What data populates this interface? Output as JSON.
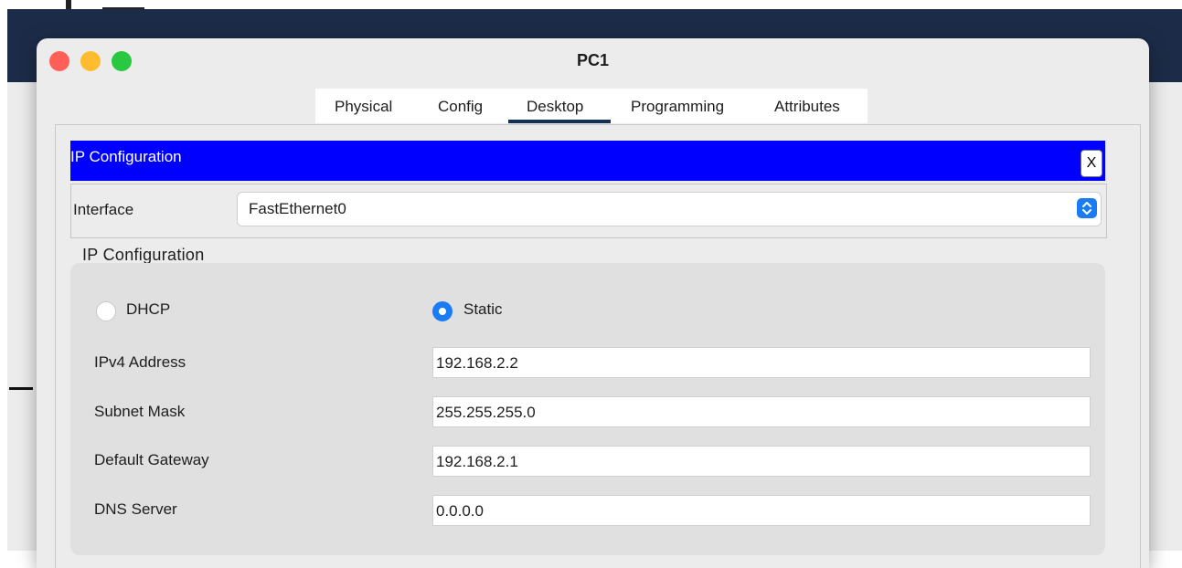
{
  "window": {
    "title": "PC1"
  },
  "tabs": [
    {
      "label": "Physical"
    },
    {
      "label": "Config"
    },
    {
      "label": "Desktop"
    },
    {
      "label": "Programming"
    },
    {
      "label": "Attributes"
    }
  ],
  "active_tab": "Desktop",
  "panel": {
    "title": "IP Configuration",
    "close_label": "X"
  },
  "interface": {
    "label": "Interface",
    "value": "FastEthernet0"
  },
  "ip_config": {
    "group_title": "IP Configuration",
    "mode_options": [
      {
        "label": "DHCP",
        "selected": false
      },
      {
        "label": "Static",
        "selected": true
      }
    ],
    "fields": [
      {
        "label": "IPv4 Address",
        "value": "192.168.2.2"
      },
      {
        "label": "Subnet Mask",
        "value": "255.255.255.0"
      },
      {
        "label": "Default Gateway",
        "value": "192.168.2.1"
      },
      {
        "label": "DNS Server",
        "value": "0.0.0.0"
      }
    ]
  },
  "colors": {
    "header_blue": "#0000ff",
    "accent_blue": "#1a7cf4",
    "tab_underline": "#143058",
    "close_red": "#ff5f57",
    "minimize_yellow": "#febc2e",
    "zoom_green": "#28c840"
  },
  "icons": [
    "close-traffic-light-icon",
    "minimize-traffic-light-icon",
    "zoom-traffic-light-icon",
    "select-arrows-icon"
  ]
}
